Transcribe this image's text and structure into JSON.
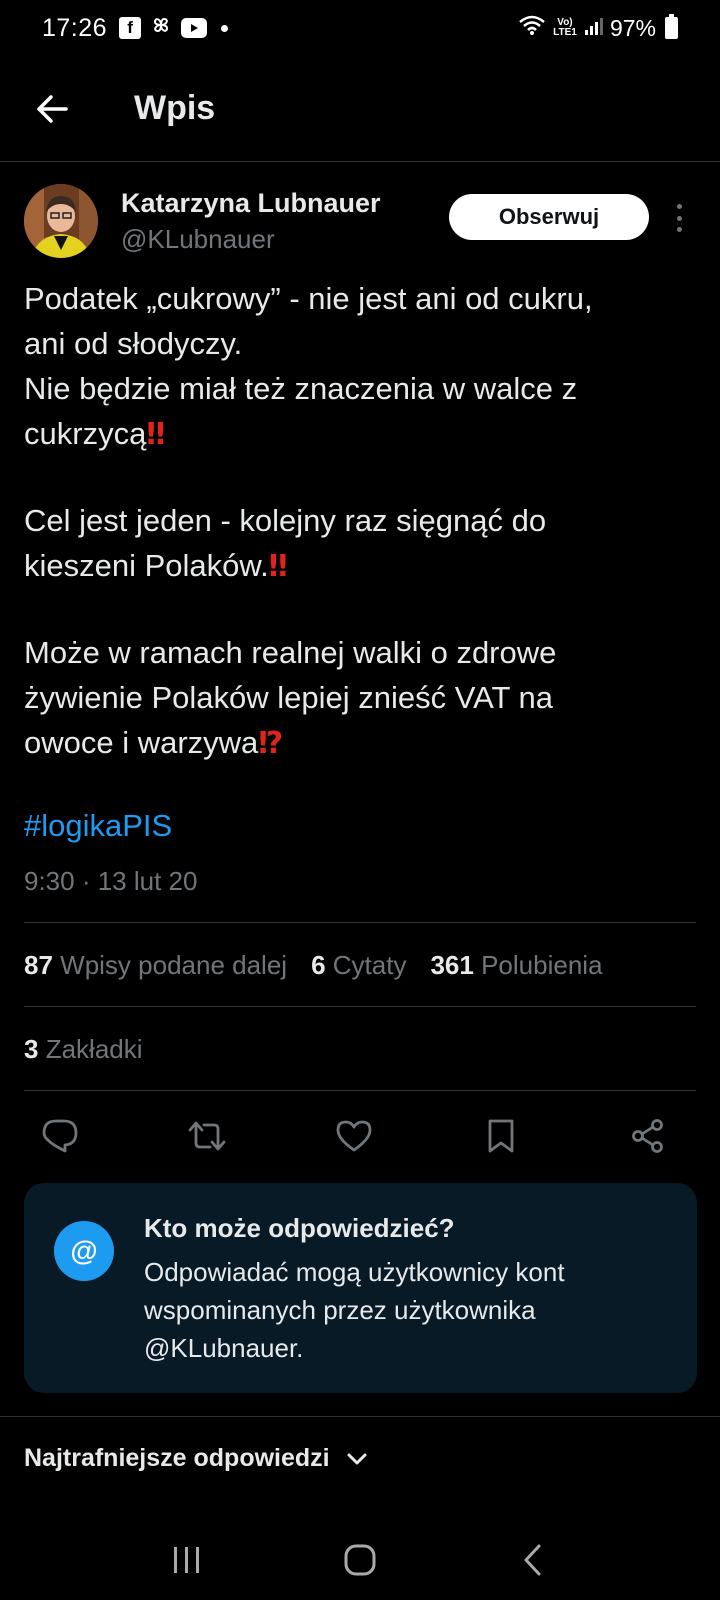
{
  "status_bar": {
    "time": "17:26",
    "lte_label": "Vo) LTE1",
    "battery": "97%"
  },
  "header": {
    "title": "Wpis"
  },
  "author": {
    "name": "Katarzyna Lubnauer",
    "handle": "@KLubnauer",
    "follow_label": "Obserwuj"
  },
  "tweet": {
    "lines": [
      "Podatek „cukrowy” - nie jest ani od cukru,",
      "ani od słodyczy.",
      "Nie będzie miał też znaczenia w walce z",
      "cukrzycą",
      "Cel jest jeden - kolejny raz sięgnąć do",
      "kieszeni Polaków.",
      "Może w ramach realnej walki o zdrowe",
      "żywienie Polaków lepiej znieść VAT na",
      "owoce i warzywa"
    ],
    "emoji_double_exclamation": "‼",
    "emoji_interrobang": "⁉",
    "hashtag": "#logikaPIS",
    "timestamp": "9:30 · 13 lut 20"
  },
  "stats": {
    "retweets_count": "87",
    "retweets_label": "Wpisy podane dalej",
    "quotes_count": "6",
    "quotes_label": "Cytaty",
    "likes_count": "361",
    "likes_label": "Polubienia",
    "bookmarks_count": "3",
    "bookmarks_label": "Zakładki"
  },
  "reply_card": {
    "icon": "@",
    "title": "Kto może odpowiedzieć?",
    "description": "Odpowiadać mogą użytkownicy kont wspominanych przez użytkownika @KLubnauer."
  },
  "sort": {
    "label": "Najtrafniejsze odpowiedzi"
  },
  "colors": {
    "accent": "#1d9bf0",
    "background": "#000000",
    "secondary_text": "#71767b",
    "card_bg": "#071a26",
    "emoji_red": "#e0241b"
  },
  "icons": [
    "back-arrow-icon",
    "facebook-icon",
    "pinwheel-icon",
    "youtube-icon",
    "wifi-icon",
    "signal-icon",
    "battery-icon",
    "more-vertical-icon",
    "reply-icon",
    "retweet-icon",
    "like-icon",
    "bookmark-icon",
    "share-icon",
    "at-icon",
    "chevron-down-icon",
    "recents-icon",
    "home-icon",
    "back-icon"
  ]
}
